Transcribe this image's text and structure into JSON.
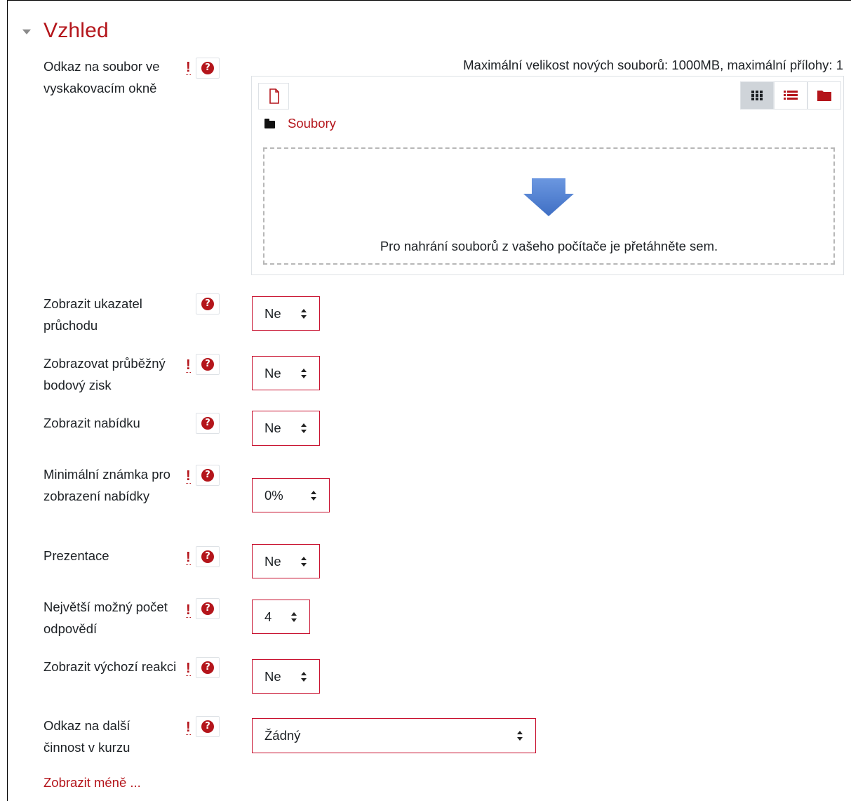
{
  "section": {
    "title": "Vzhled"
  },
  "filepicker": {
    "label": "Odkaz na soubor ve vyskakovacím okně",
    "max_size_text": "Maximální velikost nových souborů: 1000MB, maximální přílohy: 1",
    "folder_label": "Soubory",
    "drop_text": "Pro nahrání souborů z vašeho počítače je přetáhněte sem."
  },
  "fields": {
    "progress_bar": {
      "label": "Zobrazit ukazatel průchodu",
      "value": "Ne"
    },
    "ongoing_score": {
      "label": "Zobrazovat průběžný bodový zisk",
      "value": "Ne"
    },
    "display_menu": {
      "label": "Zobrazit nabídku",
      "value": "Ne"
    },
    "min_grade": {
      "label": "Minimální známka pro zobrazení nabídky",
      "value": "0%"
    },
    "slideshow": {
      "label": "Prezentace",
      "value": "Ne"
    },
    "max_answers": {
      "label": "Největší možný počet odpovědí",
      "value": "4"
    },
    "default_feedback": {
      "label": "Zobrazit výchozí reakci",
      "value": "Ne"
    },
    "next_activity": {
      "label": "Odkaz na další činnost v kurzu",
      "value": "Žádný"
    }
  },
  "show_less": "Zobrazit méně ...",
  "colors": {
    "accent": "#b4151b",
    "border": "#c8102e",
    "arrow": "#4f7fd0"
  }
}
